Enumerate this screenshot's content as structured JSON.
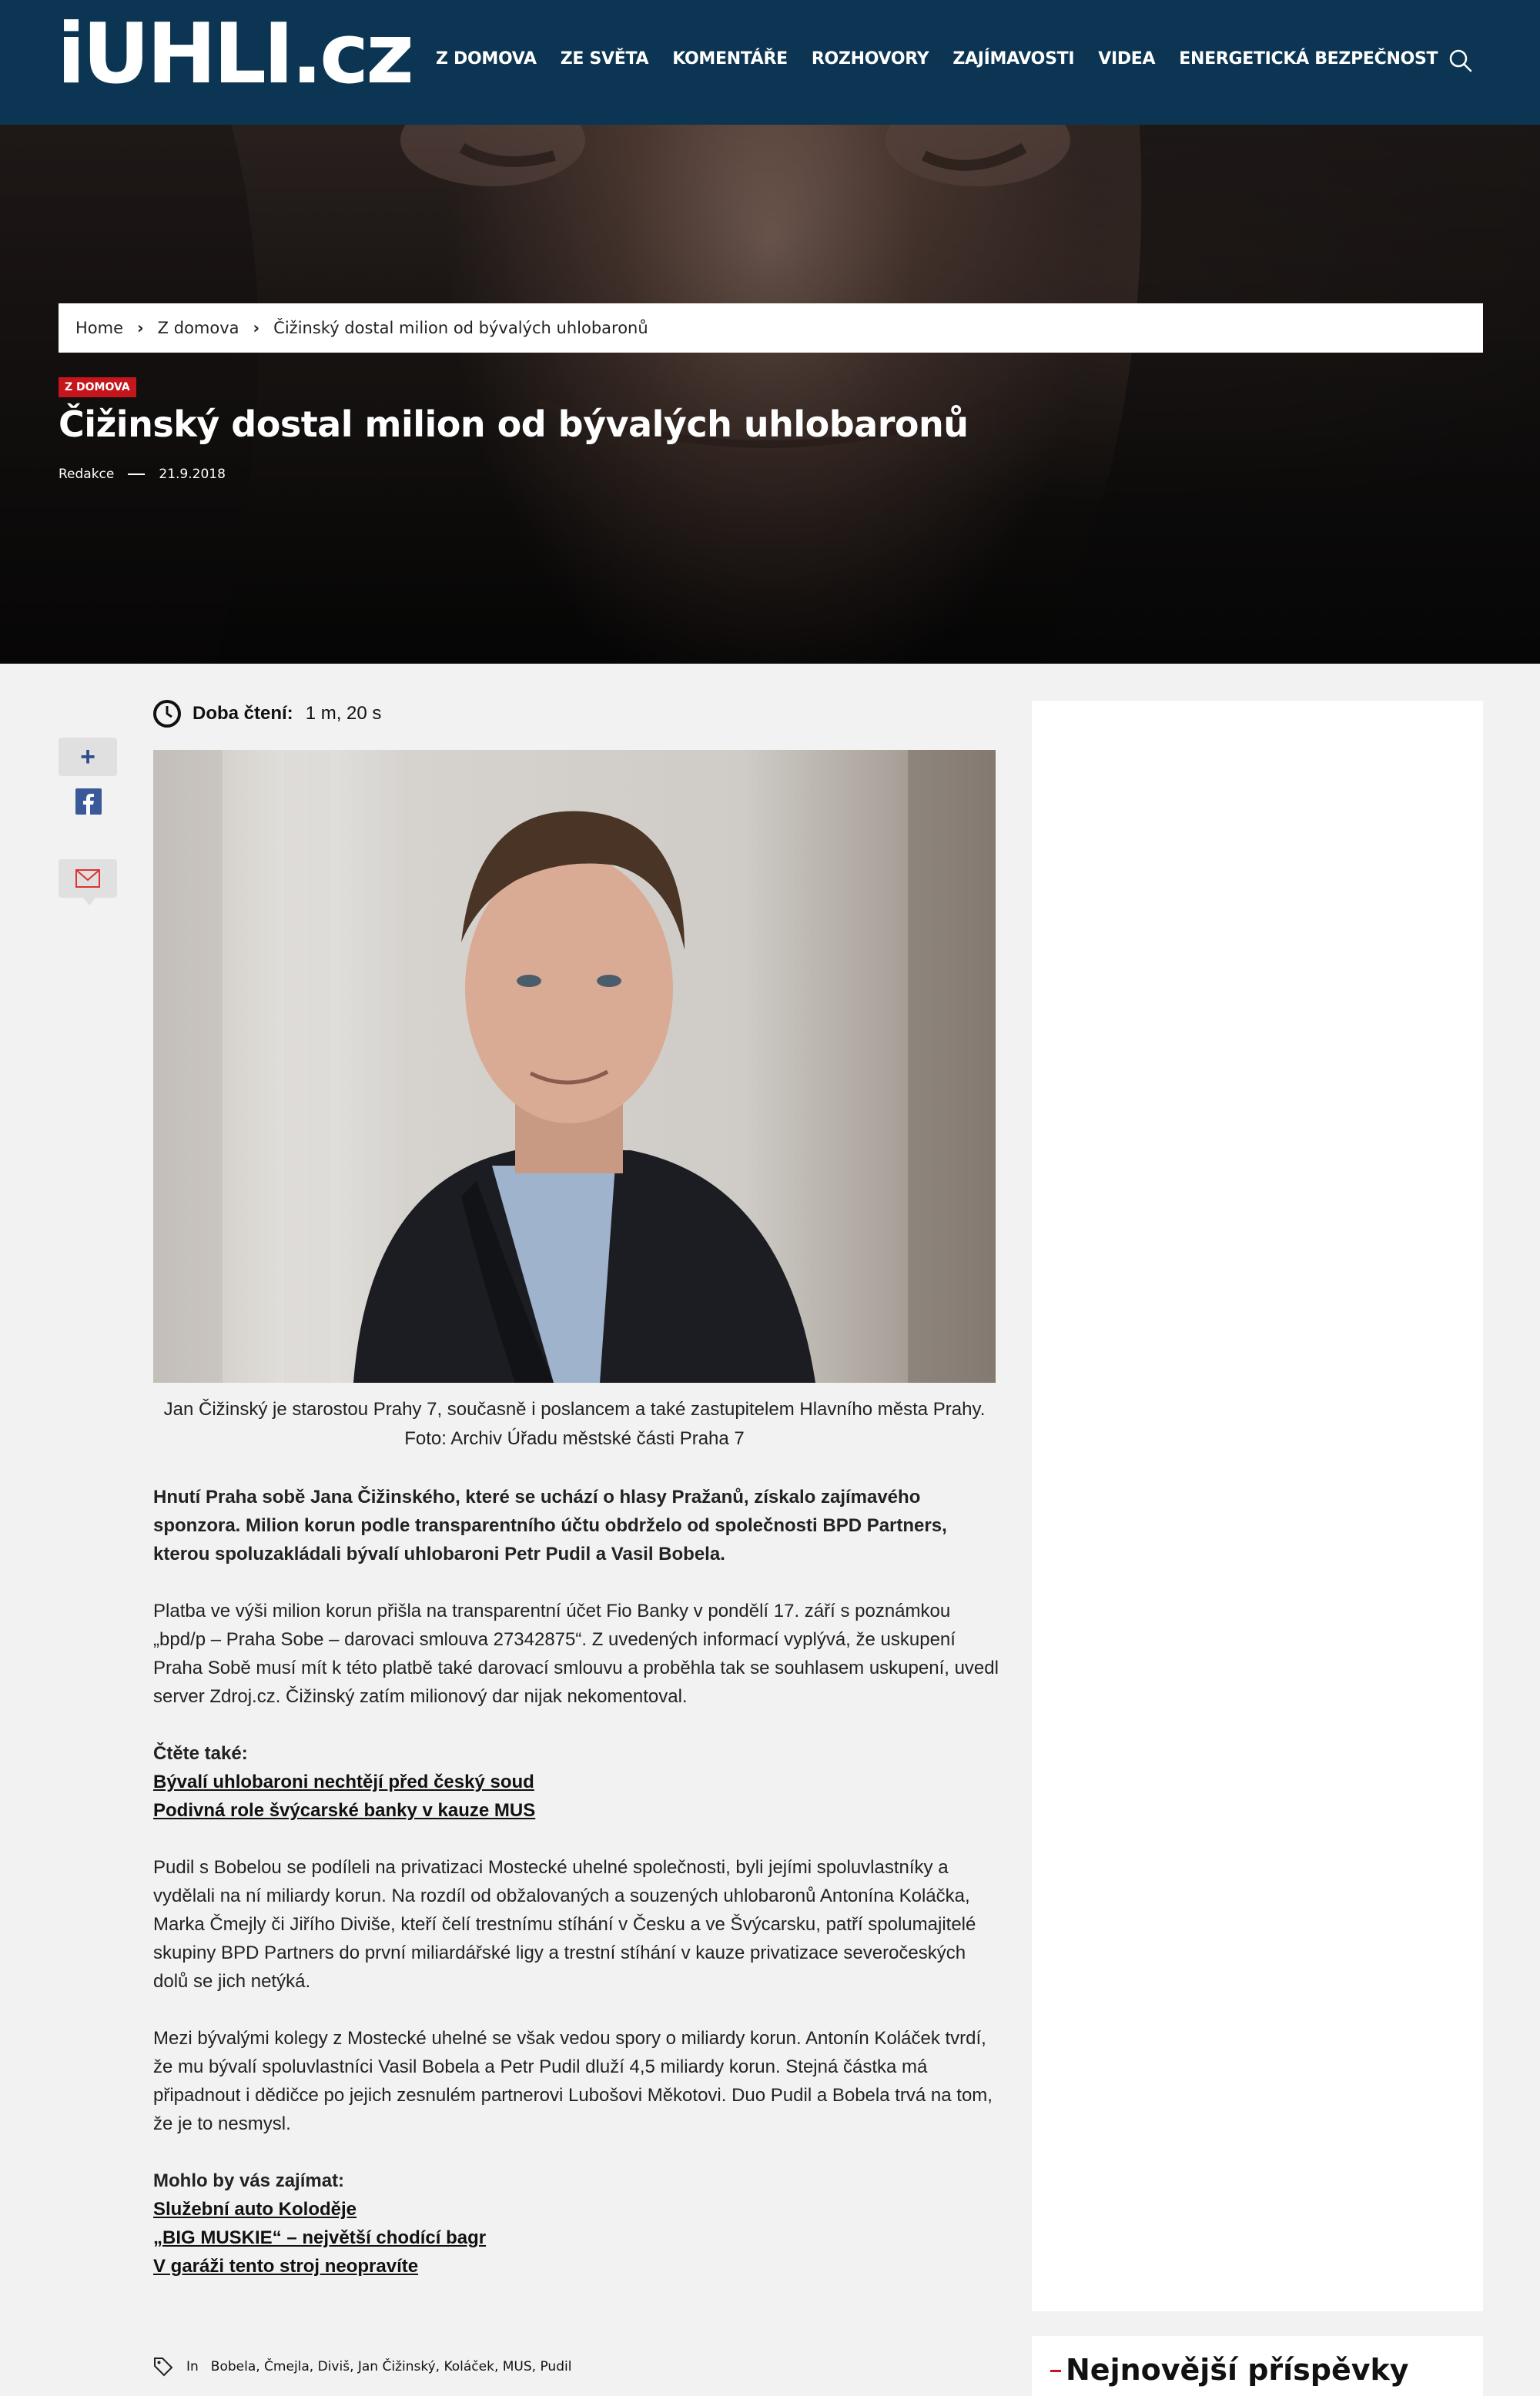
{
  "header": {
    "logo": "iUHLI.cz",
    "nav": [
      "Z DOMOVA",
      "ZE SVĚTA",
      "KOMENTÁŘE",
      "ROZHOVORY",
      "ZAJÍMAVOSTI",
      "VIDEA",
      "ENERGETICKÁ BEZPEČNOST"
    ],
    "search_icon": "search-icon"
  },
  "breadcrumb": [
    "Home",
    "Z domova",
    "Čižinský dostal milion od bývalých uhlobaronů"
  ],
  "article": {
    "category": "Z DOMOVA",
    "title": "Čižinský dostal milion od bývalých uhlobaronů",
    "author": "Redakce",
    "date": "21.9.2018",
    "reading_label": "Doba čtení:",
    "reading_time": "1 m, 20 s",
    "caption_line1": "Jan Čižinský je starostou Prahy 7, současně i poslancem a také zastupitelem Hlavního města Prahy.",
    "caption_line2": "Foto: Archiv Úřadu městské části Praha 7",
    "lead": "Hnutí Praha sobě Jana Čižinského, které se uchází o hlasy Pražanů, získalo zajímavého sponzora. Milion korun podle transparentního účtu obdrželo od společnosti BPD Partners, kterou spoluzakládali bývalí uhlobaroni Petr Pudil a Vasil Bobela.",
    "p1": "Platba ve výši milion korun přišla na transparentní účet Fio Banky v pondělí 17. září s poznámkou „bpd/p – Praha Sobe – darovaci smlouva 27342875“. Z uvedených informací vyplývá, že uskupení Praha Sobě musí mít k této platbě také darovací smlouvu a proběhla tak se souhlasem uskupení, uvedl server Zdroj.cz. Čižinský zatím milionový dar nijak nekomentoval.",
    "read_also_label": "Čtěte také:",
    "read_also_links": [
      "Bývalí uhlobaroni nechtějí před český soud",
      "Podivná role švýcarské banky v kauze MUS"
    ],
    "p2": "Pudil s Bobelou se podíleli na privatizaci Mostecké uhelné společnosti, byli jejími spoluvlastníky a vydělali na ní miliardy korun. Na rozdíl od obžalovaných a souzených uhlobaronů Antonína Koláčka, Marka Čmejly či Jiřího Diviše, kteří čelí trestnímu stíhání v Česku a ve Švýcarsku, patří spolumajitelé skupiny BPD Partners do první miliardářské ligy a trestní stíhání v kauze privatizace severočeských dolů se jich netýká.",
    "p3": "Mezi bývalými kolegy z Mostecké uhelné se však vedou spory o miliardy korun. Antonín Koláček tvrdí, že mu bývalí spoluvlastníci Vasil Bobela a Petr Pudil dluží 4,5 miliardy korun. Stejná částka má připadnout i dědičce po jejich zesnulém partnerovi Lubošovi Měkotovi. Duo Pudil a Bobela trvá na tom, že je to nesmysl.",
    "interest_label": "Mohlo by vás zajímat:",
    "interest_links": [
      "Služební auto Koloděje",
      "„BIG MUSKIE“ – největší chodící bagr",
      "V garáži tento stroj neopravíte"
    ],
    "tags_prefix": "In",
    "tags": "Bobela, Čmejla, Diviš, Jan Čižinský, Koláček, MUS, Pudil"
  },
  "sidebar": {
    "latest_title": "Nejnovější příspěvky"
  },
  "colors": {
    "header_bg": "#0b3552",
    "badge": "#c4161c",
    "facebook": "#3b5998"
  }
}
